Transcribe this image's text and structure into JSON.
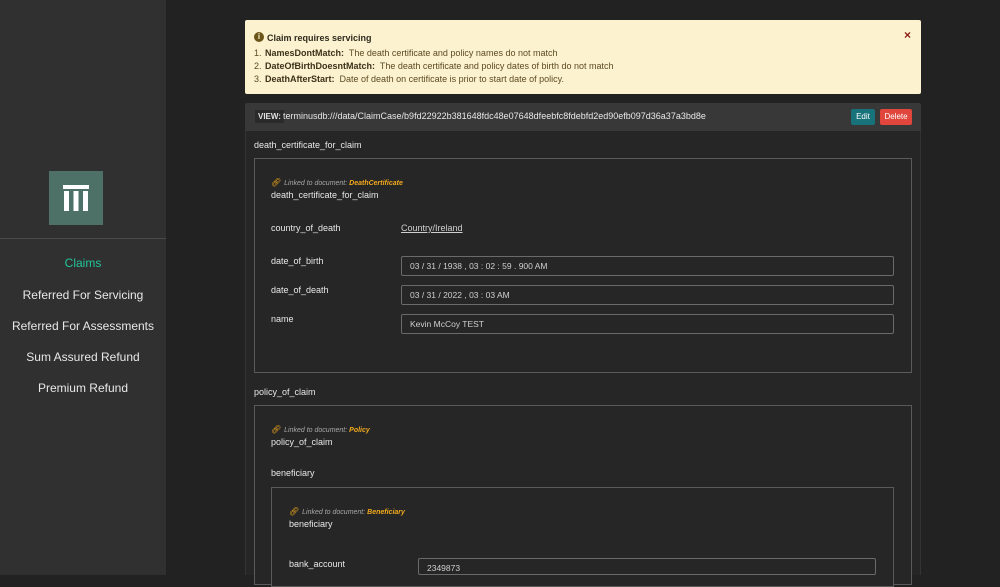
{
  "sidebar": {
    "items": [
      {
        "label": "Claims",
        "active": true
      },
      {
        "label": "Referred For Servicing"
      },
      {
        "label": "Referred For Assessments"
      },
      {
        "label": "Sum Assured Refund"
      },
      {
        "label": "Premium Refund"
      }
    ]
  },
  "alert": {
    "title": "Claim requires servicing",
    "close_icon": "×",
    "items": [
      {
        "num": "1.",
        "code": "NamesDontMatch:",
        "text": "The death certificate and policy names do not match"
      },
      {
        "num": "2.",
        "code": "DateOfBirthDoesntMatch:",
        "text": "The death certificate and policy dates of birth do not match"
      },
      {
        "num": "3.",
        "code": "DeathAfterStart:",
        "text": "Date of death on certificate is prior to start date of policy."
      }
    ]
  },
  "viewbar": {
    "tag": "VIEW:",
    "uri": "terminusdb:///data/ClaimCase/b9fd22922b381648fdc48e07648dfeebfc8fdebfd2ed90efb097d36a37a3bd8e",
    "edit_label": "Edit",
    "delete_label": "Delete"
  },
  "death_certificate": {
    "section_title": "death_certificate_for_claim",
    "linked_prefix": "Linked to document:",
    "linked_doc": "DeathCertificate",
    "subtitle": "death_certificate_for_claim",
    "fields": {
      "country_label": "country_of_death",
      "country_value": "Country/Ireland",
      "dob_label": "date_of_birth",
      "dob_value": "03 / 31 / 1938 ,  03 : 02 : 59 . 900   AM",
      "dod_label": "date_of_death",
      "dod_value": "03 / 31 / 2022 ,  03 : 03   AM",
      "name_label": "name",
      "name_value": "Kevin McCoy TEST"
    }
  },
  "policy": {
    "section_title": "policy_of_claim",
    "linked_prefix": "Linked to document:",
    "linked_doc": "Policy",
    "subtitle": "policy_of_claim",
    "beneficiary_label": "beneficiary",
    "beneficiary": {
      "linked_prefix": "Linked to document:",
      "linked_doc": "Beneficiary",
      "subtitle": "beneficiary",
      "bank_account_label": "bank_account",
      "bank_account_value": "2349873"
    }
  },
  "colors": {
    "accent": "#22c59a",
    "logo_bg": "#4d7167",
    "alert_bg": "#fcf2cf",
    "edit_btn": "#17727a",
    "delete_btn": "#e0463c",
    "link_doc": "#f2a91c"
  },
  "icons": {
    "logo": "terminus-columns-logo",
    "alert": "info-icon",
    "close": "close-icon",
    "link": "link-icon"
  }
}
